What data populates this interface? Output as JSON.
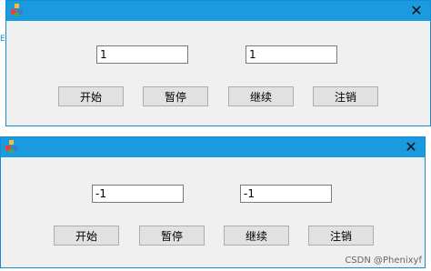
{
  "window_top": {
    "close_glyph": "✕",
    "field_left": "1",
    "field_right": "1",
    "buttons": {
      "start": "开始",
      "pause": "暂停",
      "continue": "继续",
      "cancel": "注销"
    }
  },
  "window_bottom": {
    "close_glyph": "✕",
    "field_left": "-1",
    "field_right": "-1",
    "buttons": {
      "start": "开始",
      "pause": "暂停",
      "continue": "继续",
      "cancel": "注销"
    }
  },
  "watermark": "CSDN @Phenixyf",
  "colors": {
    "titlebar": "#1a9be0",
    "client_bg": "#f0f0f0",
    "button_bg": "#e1e1e1"
  },
  "icons": {
    "app_icon": "app-icon",
    "close_icon": "close-icon"
  }
}
